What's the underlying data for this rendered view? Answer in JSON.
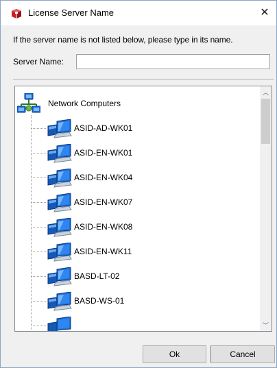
{
  "window": {
    "title": "License Server Name",
    "close_glyph": "✕",
    "app_icon": "red-box-icon"
  },
  "instructions": "If the server name is not listed below, please type in its name.",
  "server_name": {
    "label": "Server Name:",
    "value": ""
  },
  "tree": {
    "root_label": "Network Computers",
    "root_icon": "network-computers-icon",
    "item_icon": "computer-monitor-icon",
    "items": [
      "ASID-AD-WK01",
      "ASID-EN-WK01",
      "ASID-EN-WK04",
      "ASID-EN-WK07",
      "ASID-EN-WK08",
      "ASID-EN-WK11",
      "BASD-LT-02",
      "BASD-WS-01"
    ],
    "scroll_up_glyph": "︿",
    "scroll_down_glyph": "﹀"
  },
  "buttons": {
    "ok": "Ok",
    "cancel": "Cancel"
  },
  "colors": {
    "window_border": "#8aa6c8",
    "dialog_background": "#f0f0f0",
    "button_face": "#e1e1e1",
    "monitor_blue": "#1c6fd8"
  }
}
